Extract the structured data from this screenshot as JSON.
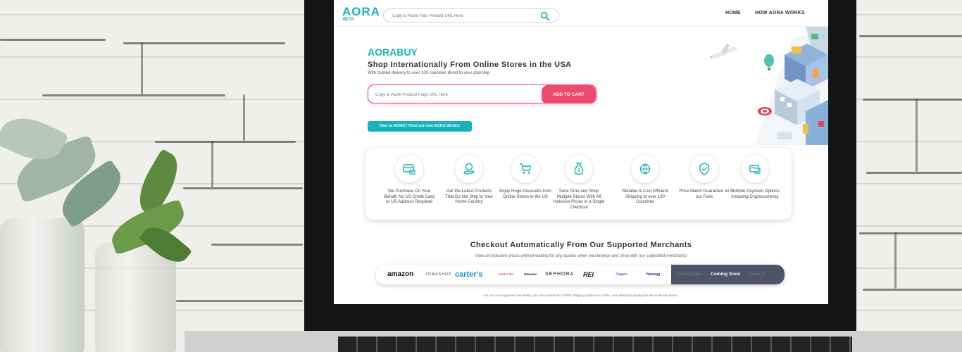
{
  "nav": {
    "logo": "AORA",
    "beta": "BETA",
    "search_placeholder": "Copy & Paste Your Product URL Here",
    "links": [
      "HOME",
      "HOW AORA WORKS"
    ]
  },
  "hero": {
    "brand": "AORABUY",
    "headline": "Shop Internationally From Online Stores in the USA",
    "subheadline": "With trusted delivery to over 100 countries direct to your doorstep",
    "search_placeholder": "Copy & Paste Product Page URL Here",
    "add_to_cart": "ADD TO CART",
    "how_link": "New to AORA? Find out how AORA Works!"
  },
  "features": [
    {
      "icon": "credit-card-icon",
      "text": "We Purchase On Your Behalf. No US Credit Card or US Address Required"
    },
    {
      "icon": "hand-globe-icon",
      "text": "Get the Latest Products That Do Not Ship to Your Home Country"
    },
    {
      "icon": "shopping-cart-icon",
      "text": "Enjoy Huge Discounts from Online Stores in the US"
    },
    {
      "icon": "money-bag-icon",
      "text": "Save Time and Shop Multiple Stores With All Inclusive Prices in a Single Checkout"
    },
    {
      "icon": "globe-shipping-icon",
      "text": "Reliable & Cost Efficient Shipping to over 100 Countries"
    },
    {
      "icon": "shield-check-icon",
      "text": "Price Match Guarantee on our Fees"
    },
    {
      "icon": "payment-card-icon",
      "text": "Multiple Payment Options Including Cryptocurrency"
    }
  ],
  "merchants": {
    "title": "Checkout Automatically From Our Supported Merchants",
    "subtitle": "View all-inclusive prices without waiting for any quotes when you browse and shop with our supported merchants!",
    "logos": [
      "amazon",
      "JOMASHOP",
      "carter's",
      "6PM.COM",
      "Glossier.",
      "SEPHORA",
      "REI",
      "Zappos",
      "Newegg"
    ],
    "coming_soon_ghosts": [
      "NORDSTROM",
      "Forever 21"
    ],
    "coming_soon_label": "Coming Soon",
    "footnote": "For our non-supported merchants, you can request for a FREE shipping quote from AORA. Get started by pasting the link in the bar above."
  },
  "colors": {
    "brand_teal": "#17b3bc",
    "accent_pink": "#ec4a6e",
    "coming_soon_bg": "#4d5466"
  }
}
